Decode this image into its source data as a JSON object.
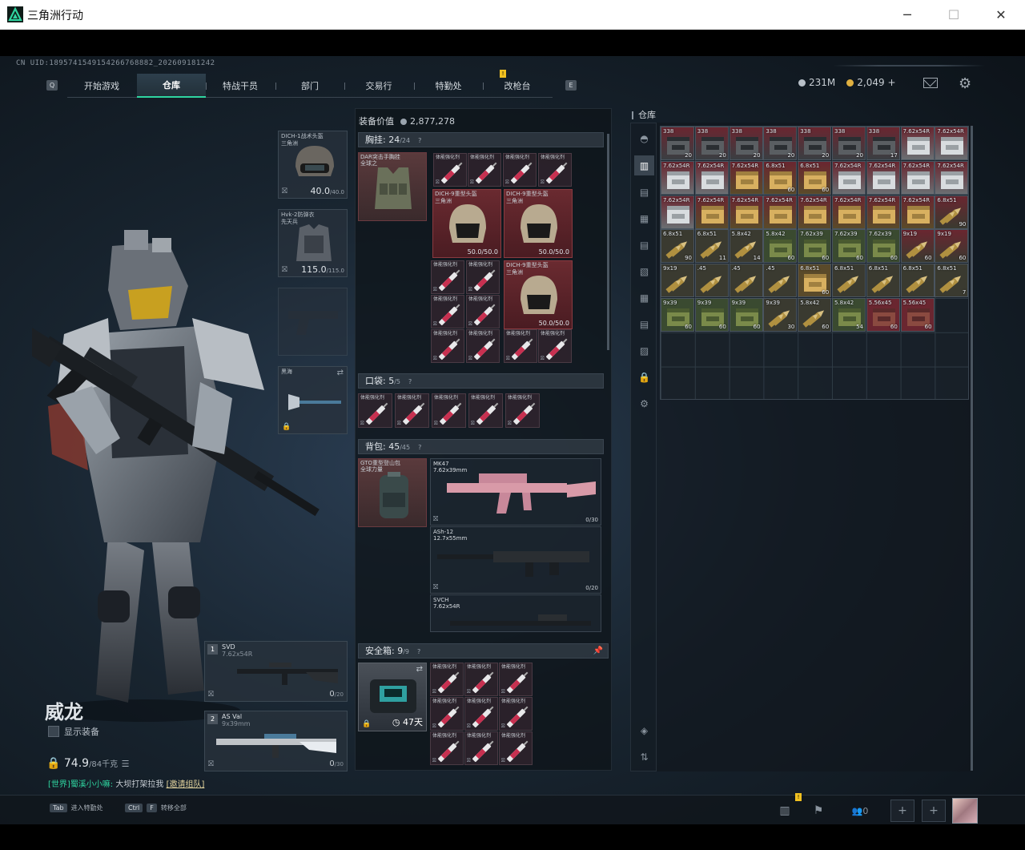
{
  "window": {
    "title": "三角洲行动"
  },
  "uid": "CN UID:1895741549154266768882_202609181242",
  "nav": {
    "key_left": "Q",
    "key_right": "E",
    "tabs": [
      {
        "label": "开始游戏",
        "active": false
      },
      {
        "label": "仓库",
        "active": true
      },
      {
        "label": "特战干员",
        "active": false
      },
      {
        "label": "部门",
        "active": false
      },
      {
        "label": "交易行",
        "active": false
      },
      {
        "label": "特勤处",
        "active": false
      },
      {
        "label": "改枪台",
        "active": false
      }
    ]
  },
  "currency": {
    "hafcoin": "231M",
    "tickets": "2,049",
    "plus": "+"
  },
  "equipment": {
    "helmet": {
      "name": "DICH-1战术头盔\n三角洲",
      "durability": "40.0",
      "max": "/40.0"
    },
    "armor": {
      "name": "Hvk-2防弹衣\n先天兵",
      "durability": "115.0",
      "max": "/115.0"
    },
    "melee": {
      "name": "黑海"
    }
  },
  "weapons": [
    {
      "num": "1",
      "name": "SVD",
      "caliber": "7.62x54R",
      "ammo": "0",
      "cap": "/20"
    },
    {
      "num": "2",
      "name": "AS Val",
      "caliber": "9x39mm",
      "ammo": "0",
      "cap": "/30"
    }
  ],
  "character": {
    "name": "威龙",
    "show_equipment": "显示装备",
    "weight": "74.9",
    "weight_max": "/84千克"
  },
  "chat": {
    "channel": "[世界]",
    "user": "蜀溪小小嘛:",
    "text": "大坝打架拉我",
    "invite": "[邀请组队]"
  },
  "loadout": {
    "value_label": "装备价值",
    "value": "2,877,278",
    "chest": {
      "label": "胸挂:",
      "count": "24",
      "max": "/24",
      "rig_name": "DAR突击手胸挂\n全球之"
    },
    "pocket": {
      "label": "口袋:",
      "count": "5",
      "max": "/5"
    },
    "backpack": {
      "label": "背包:",
      "count": "45",
      "max": "/45",
      "bag_name": "GTO重型登山包\n全球力量"
    },
    "safebox": {
      "label": "安全箱:",
      "count": "9",
      "max": "/9",
      "days": "47天"
    },
    "stim_label": "体能强化剂",
    "helmet_label": "DICH-9重型头盔\n三角洲",
    "helmet_dur": "50.0/50.0",
    "guns": [
      {
        "name": "MK47",
        "caliber": "7.62x39mm",
        "ammo": "0/30"
      },
      {
        "name": "ASh-12",
        "caliber": "12.7x55mm",
        "ammo": "0/20"
      },
      {
        "name": "SVCH",
        "caliber": "7.62x54R",
        "ammo": ""
      }
    ]
  },
  "warehouse": {
    "title": "仓库",
    "items": [
      {
        "label": "338",
        "qty": "20",
        "kind": "box-dark",
        "red": true
      },
      {
        "label": "338",
        "qty": "20",
        "kind": "box-dark",
        "red": true
      },
      {
        "label": "338",
        "qty": "20",
        "kind": "box-dark",
        "red": true
      },
      {
        "label": "338",
        "qty": "20",
        "kind": "box-dark",
        "red": true
      },
      {
        "label": "338",
        "qty": "20",
        "kind": "box-dark",
        "red": true
      },
      {
        "label": "338",
        "qty": "20",
        "kind": "box-dark",
        "red": true
      },
      {
        "label": "338",
        "qty": "17",
        "kind": "box-dark",
        "red": true
      },
      {
        "label": "7.62x54R",
        "qty": "",
        "kind": "box-white",
        "red": true
      },
      {
        "label": "7.62x54R",
        "qty": "",
        "kind": "box-white",
        "red": true
      },
      {
        "label": "7.62x54R",
        "qty": "",
        "kind": "box-white",
        "red": true
      },
      {
        "label": "7.62x54R",
        "qty": "",
        "kind": "box-white",
        "red": true
      },
      {
        "label": "7.62x54R",
        "qty": "",
        "kind": "box-gold",
        "red": true
      },
      {
        "label": "6.8x51",
        "qty": "60",
        "kind": "box-gold",
        "red": true
      },
      {
        "label": "6.8x51",
        "qty": "60",
        "kind": "box-gold",
        "red": true
      },
      {
        "label": "7.62x54R",
        "qty": "",
        "kind": "box-white",
        "red": true
      },
      {
        "label": "7.62x54R",
        "qty": "",
        "kind": "box-white",
        "red": true
      },
      {
        "label": "7.62x54R",
        "qty": "",
        "kind": "box-white",
        "red": true
      },
      {
        "label": "7.62x54R",
        "qty": "",
        "kind": "box-white",
        "red": true
      },
      {
        "label": "7.62x54R",
        "qty": "",
        "kind": "box-white",
        "red": true
      },
      {
        "label": "7.62x54R",
        "qty": "",
        "kind": "box-gold",
        "red": true
      },
      {
        "label": "7.62x54R",
        "qty": "",
        "kind": "box-gold",
        "red": true
      },
      {
        "label": "7.62x54R",
        "qty": "",
        "kind": "box-gold",
        "red": true
      },
      {
        "label": "7.62x54R",
        "qty": "",
        "kind": "box-gold",
        "red": true
      },
      {
        "label": "7.62x54R",
        "qty": "",
        "kind": "box-gold",
        "red": true
      },
      {
        "label": "7.62x54R",
        "qty": "",
        "kind": "box-gold",
        "red": true
      },
      {
        "label": "7.62x54R",
        "qty": "",
        "kind": "box-gold",
        "red": true
      },
      {
        "label": "6.8x51",
        "qty": "90",
        "kind": "round",
        "red": true
      },
      {
        "label": "6.8x51",
        "qty": "90",
        "kind": "round",
        "red": false
      },
      {
        "label": "6.8x51",
        "qty": "11",
        "kind": "round",
        "red": false
      },
      {
        "label": "5.8x42",
        "qty": "14",
        "kind": "round",
        "red": false
      },
      {
        "label": "5.8x42",
        "qty": "60",
        "kind": "box-green",
        "red": false
      },
      {
        "label": "7.62x39",
        "qty": "60",
        "kind": "box-green",
        "red": false
      },
      {
        "label": "7.62x39",
        "qty": "60",
        "kind": "box-green",
        "red": false
      },
      {
        "label": "7.62x39",
        "qty": "60",
        "kind": "box-green",
        "red": false
      },
      {
        "label": "9x19",
        "qty": "60",
        "kind": "round",
        "red": true
      },
      {
        "label": "9x19",
        "qty": "60",
        "kind": "round",
        "red": true
      },
      {
        "label": "9x19",
        "qty": "",
        "kind": "round",
        "red": false
      },
      {
        "label": ".45",
        "qty": "",
        "kind": "round",
        "red": false
      },
      {
        "label": ".45",
        "qty": "",
        "kind": "round",
        "red": false
      },
      {
        "label": ".45",
        "qty": "",
        "kind": "round",
        "red": false
      },
      {
        "label": "6.8x51",
        "qty": "60",
        "kind": "box-gold",
        "red": false
      },
      {
        "label": "6.8x51",
        "qty": "",
        "kind": "round",
        "red": false
      },
      {
        "label": "6.8x51",
        "qty": "",
        "kind": "round",
        "red": false
      },
      {
        "label": "6.8x51",
        "qty": "",
        "kind": "round",
        "red": false
      },
      {
        "label": "6.8x51",
        "qty": "7",
        "kind": "round",
        "red": false
      },
      {
        "label": "9x39",
        "qty": "60",
        "kind": "box-green",
        "red": false
      },
      {
        "label": "9x39",
        "qty": "60",
        "kind": "box-green",
        "red": false
      },
      {
        "label": "9x39",
        "qty": "60",
        "kind": "box-green",
        "red": false
      },
      {
        "label": "9x39",
        "qty": "30",
        "kind": "round",
        "red": false
      },
      {
        "label": "5.8x42",
        "qty": "60",
        "kind": "round",
        "red": false
      },
      {
        "label": "5.8x42",
        "qty": "54",
        "kind": "box-green",
        "red": false
      },
      {
        "label": "5.56x45",
        "qty": "60",
        "kind": "box-red",
        "red": true
      },
      {
        "label": "5.56x45",
        "qty": "60",
        "kind": "box-red",
        "red": true
      }
    ]
  },
  "bottom": {
    "hint1_key": "Tab",
    "hint1": "进入特勤处",
    "hint2_key1": "Ctrl",
    "hint2_key2": "F",
    "hint2": "转移全部",
    "team_count": "0",
    "add": "+"
  },
  "colors": {
    "accent": "#2fd5a0",
    "red_item": "#6a2630",
    "gold": "#f0c020"
  }
}
